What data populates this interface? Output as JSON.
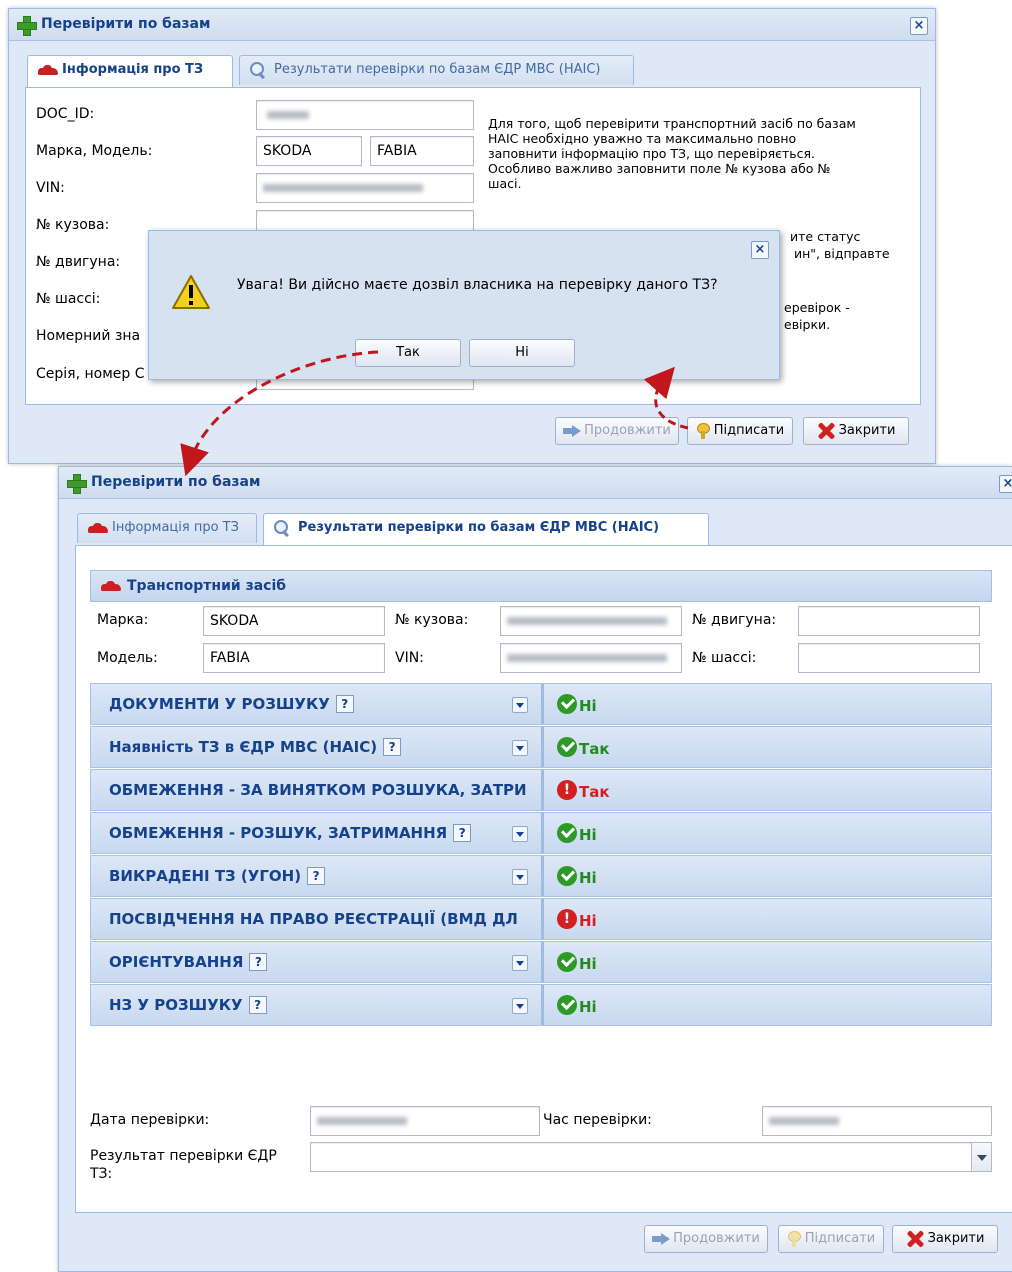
{
  "window1": {
    "title": "Перевірити по базам",
    "close_glyph": "×",
    "tabs": [
      {
        "label": "Інформація про ТЗ",
        "icon": "car-icon",
        "active": true
      },
      {
        "label": "Результати перевірки по базам ЄДР МВС (НАІС)",
        "icon": "magnifier-icon",
        "active": false
      }
    ],
    "form": {
      "doc_id_label": "DOC_ID:",
      "brand_model_label": "Марка, Модель:",
      "brand_value": "SKODA",
      "model_value": "FABIA",
      "vin_label": "VIN:",
      "body_no_label": "№ кузова:",
      "engine_no_label": "№ двигуна:",
      "chassis_no_label": "№ шассі:",
      "plate_label": "Номерний зна",
      "series_label": "Серія, номер С"
    },
    "info_text": [
      "Для того, щоб перевірити транспортний засіб по базам",
      "НАІС необхідно уважно та максимально повно",
      "заповнити інформацію про ТЗ, що перевіряється.",
      "Особливо важливо заповнити поле № кузова або №",
      "шасі."
    ],
    "info_text_partial": [
      "ите статус",
      "ин\", відправте",
      "еревірок -",
      "евірки."
    ],
    "buttons": {
      "continue": "Продовжити",
      "sign": "Підписати",
      "close": "Закрити"
    }
  },
  "dialog": {
    "message": "Увага! Ви дійсно маєте дозвіл власника на перевірку даного ТЗ?",
    "yes": "Так",
    "no": "Ні",
    "close_glyph": "×",
    "icon": "warning-icon"
  },
  "window2": {
    "title": "Перевірити по базам",
    "close_glyph": "×",
    "tabs": [
      {
        "label": "Інформація про ТЗ",
        "icon": "car-icon",
        "active": false
      },
      {
        "label": "Результати перевірки по базам ЄДР МВС (НАІС)",
        "icon": "magnifier-icon",
        "active": true
      }
    ],
    "vehicle_section": "Транспортний засіб",
    "vehicle": {
      "brand_label": "Марка:",
      "brand": "SKODA",
      "model_label": "Модель:",
      "model": "FABIA",
      "body_label": "№ кузова:",
      "vin_label": "VIN:",
      "engine_label": "№ двигуна:",
      "chassis_label": "№ шассі:"
    },
    "checks": [
      {
        "label": "ДОКУМЕНТИ У РОЗШУКУ",
        "help": "?",
        "dropdown": true,
        "result": "Ні",
        "status": "ok"
      },
      {
        "label": "Наявність ТЗ в ЄДР МВС (НАІС)",
        "help": "?",
        "dropdown": true,
        "result": "Так",
        "status": "ok"
      },
      {
        "label": "ОБМЕЖЕННЯ - ЗА ВИНЯТКОМ РОЗШУКА, ЗАТРИ",
        "help": "",
        "dropdown": false,
        "result": "Так",
        "status": "bad"
      },
      {
        "label": "ОБМЕЖЕННЯ - РОЗШУК, ЗАТРИМАННЯ",
        "help": "?",
        "dropdown": true,
        "result": "Ні",
        "status": "ok"
      },
      {
        "label": "ВИКРАДЕНІ ТЗ (УГОН)",
        "help": "?",
        "dropdown": true,
        "result": "Ні",
        "status": "ok"
      },
      {
        "label": "ПОСВІДЧЕННЯ НА ПРАВО РЕЄСТРАЦІЇ (ВМД ДЛ",
        "help": "",
        "dropdown": false,
        "result": "Ні",
        "status": "bad"
      },
      {
        "label": "ОРІЄНТУВАННЯ",
        "help": "?",
        "dropdown": true,
        "result": "Ні",
        "status": "ok"
      },
      {
        "label": "НЗ У РОЗШУКУ",
        "help": "?",
        "dropdown": true,
        "result": "Ні",
        "status": "ok"
      }
    ],
    "date_label": "Дата перевірки:",
    "time_label": "Час перевірки:",
    "result_label_1": "Результат перевірки ЄДР",
    "result_label_2": "ТЗ:",
    "buttons": {
      "continue": "Продовжити",
      "sign": "Підписати",
      "close": "Закрити"
    }
  },
  "colors": {
    "accent": "#15428b",
    "ok": "#238a1e",
    "bad": "#d31f1f",
    "arrow": "#c0161c"
  }
}
